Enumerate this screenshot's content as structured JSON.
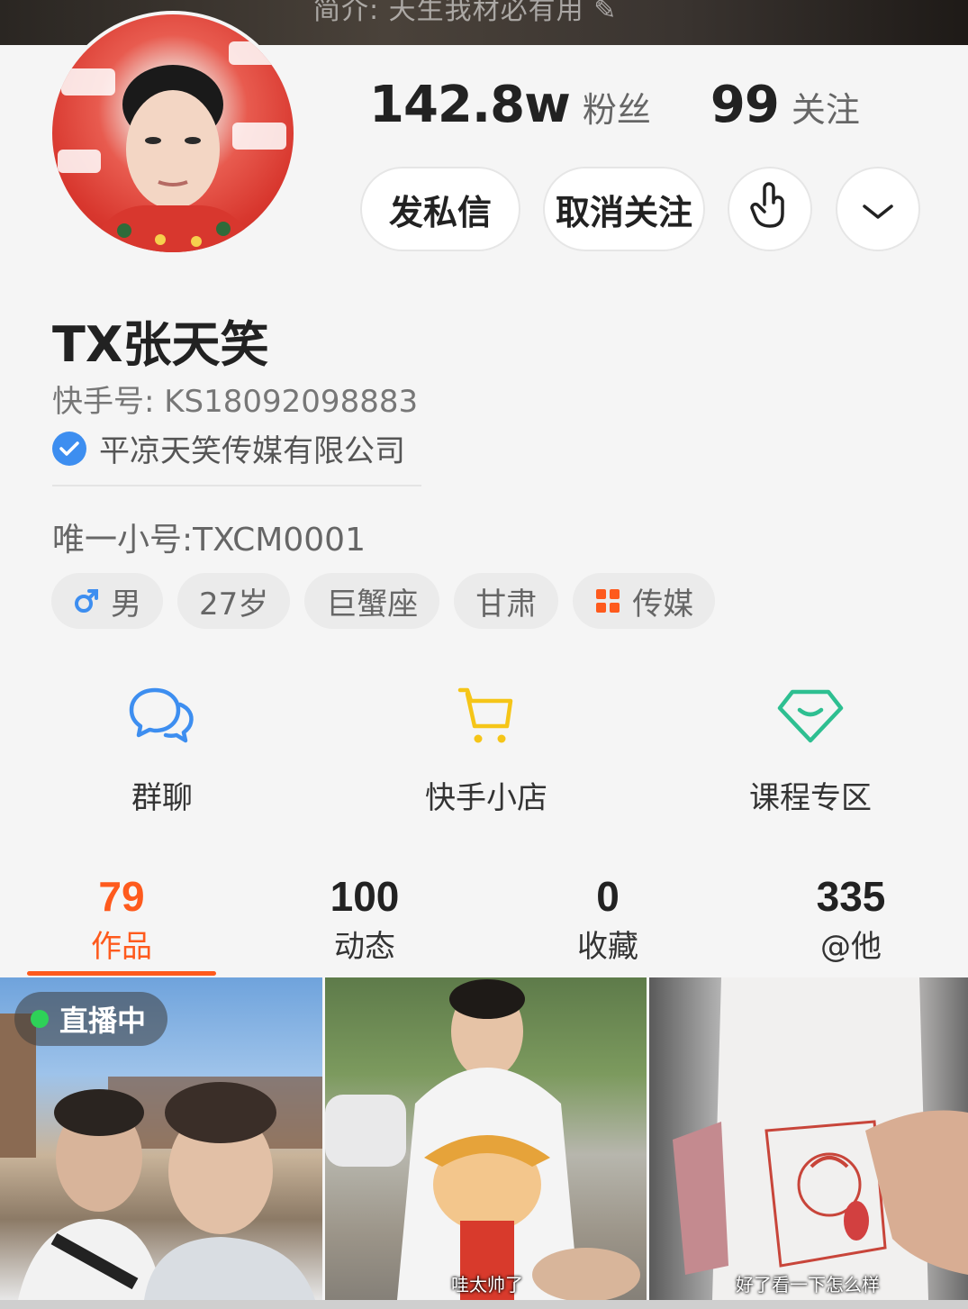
{
  "banner": {
    "text": "简介: 天生我材必有用 ✎"
  },
  "profile": {
    "avatar_icon": "avatar",
    "name": "TX张天笑",
    "ks_id": "快手号: KS18092098883",
    "verified_org": "平凉天笑传媒有限公司",
    "alt_account": "唯一小号:TXCM0001"
  },
  "stats": {
    "fans_num": "142.8w",
    "fans_label": "粉丝",
    "follow_num": "99",
    "follow_label": "关注"
  },
  "actions": {
    "message": "发私信",
    "unfollow": "取消关注",
    "hand_icon": "pointer-hand-icon",
    "more_icon": "chevron-down-icon"
  },
  "tags": [
    {
      "icon": "male-icon",
      "label": "男"
    },
    {
      "label": "27岁"
    },
    {
      "label": "巨蟹座"
    },
    {
      "label": "甘肃"
    },
    {
      "icon": "grid-icon",
      "label": "传媒"
    }
  ],
  "features": [
    {
      "icon": "chat-bubbles-icon",
      "label": "群聊"
    },
    {
      "icon": "cart-icon",
      "label": "快手小店"
    },
    {
      "icon": "diamond-icon",
      "label": "课程专区"
    }
  ],
  "tabs": [
    {
      "count": "79",
      "label": "作品",
      "active": true
    },
    {
      "count": "100",
      "label": "动态"
    },
    {
      "count": "0",
      "label": "收藏"
    },
    {
      "count": "335",
      "label": "@他"
    }
  ],
  "videos": [
    {
      "badge": "直播中",
      "caption": ""
    },
    {
      "caption": "哇太帅了"
    },
    {
      "caption": "好了看一下怎么样"
    }
  ],
  "colors": {
    "accent": "#fe5a1d",
    "verify_blue": "#3d8ef0",
    "chat_blue": "#3d8ef0",
    "cart_yellow": "#f5c518",
    "diamond_green": "#2ebf91",
    "live_green": "#2ed158"
  }
}
